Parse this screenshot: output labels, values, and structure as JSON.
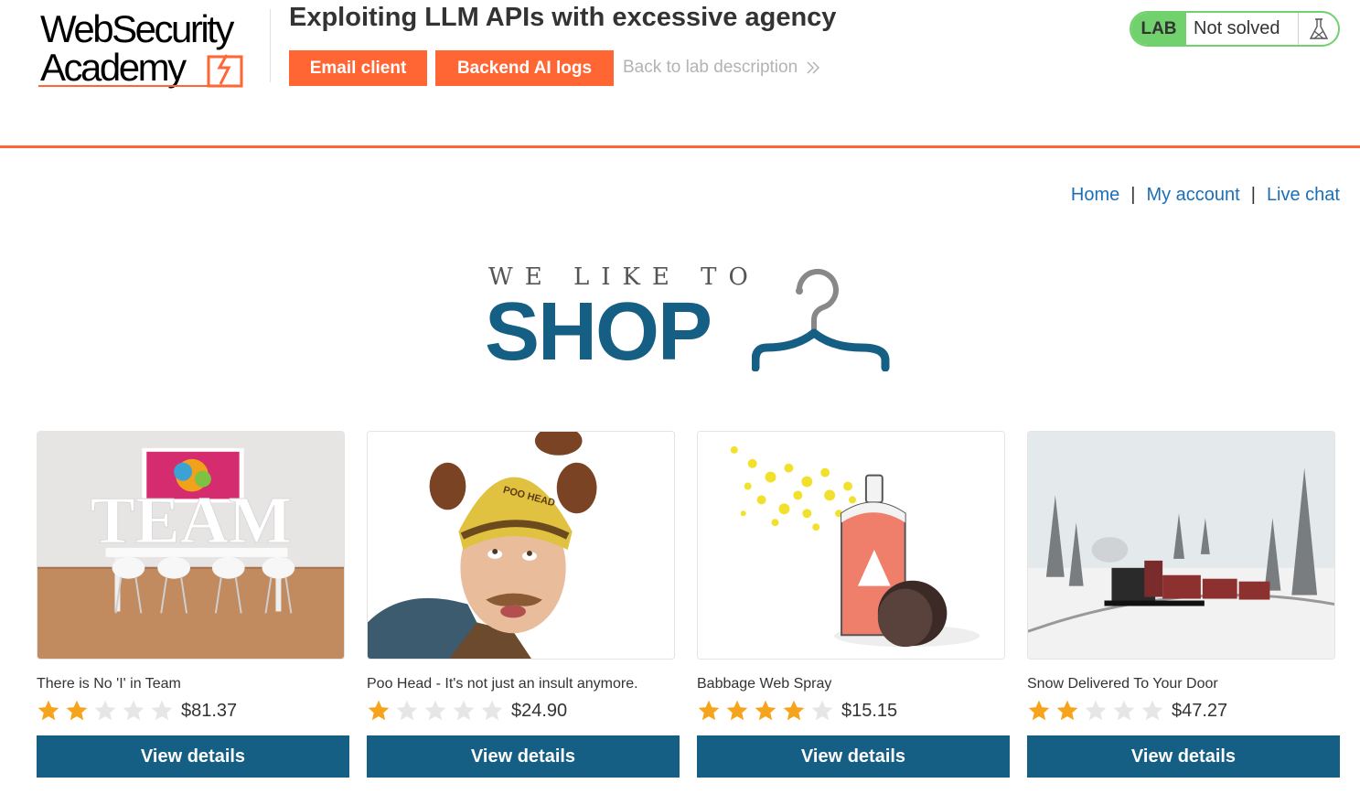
{
  "academy": {
    "logo_line1": "WebSecurity",
    "logo_line2": "Academy",
    "lab_title": "Exploiting LLM APIs with excessive agency",
    "email_client_label": "Email client",
    "backend_logs_label": "Backend AI logs",
    "back_link_label": "Back to lab description",
    "lab_badge": "LAB",
    "lab_status": "Not solved",
    "accent_color": "#ff6633",
    "solved_color": "#70d16d"
  },
  "nav": {
    "home": "Home",
    "separator": "|",
    "my_account": "My account",
    "live_chat": "Live chat"
  },
  "banner": {
    "small_text": "WE LIKE TO",
    "big_text": "SHOP",
    "brand_color": "#155e84"
  },
  "products": [
    {
      "name": "There is No 'I' in Team",
      "price": "$81.37",
      "rating": 2,
      "button": "View details",
      "image": "team-meeting-room"
    },
    {
      "name": "Poo Head - It's not just an insult anymore.",
      "price": "$24.90",
      "rating": 1,
      "button": "View details",
      "image": "poo-head-hat-man"
    },
    {
      "name": "Babbage Web Spray",
      "price": "$15.15",
      "rating": 4,
      "button": "View details",
      "image": "spray-can"
    },
    {
      "name": "Snow Delivered To Your Door",
      "price": "$47.27",
      "rating": 2,
      "button": "View details",
      "image": "snow-train"
    }
  ]
}
